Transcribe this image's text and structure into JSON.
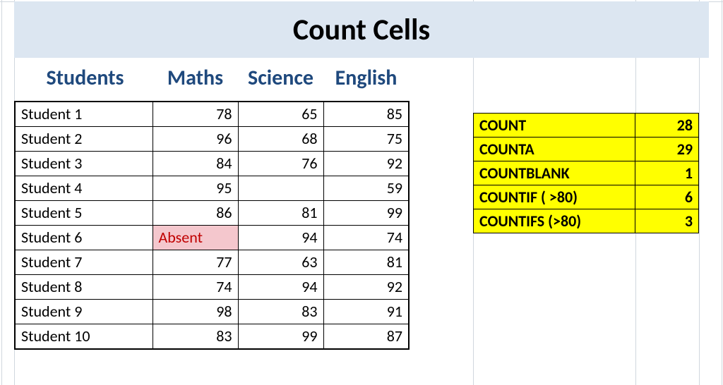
{
  "title": "Count Cells",
  "headers": {
    "students": "Students",
    "maths": "Maths",
    "science": "Science",
    "english": "English"
  },
  "rows": [
    {
      "name": "Student 1",
      "maths": "78",
      "science": "65",
      "english": "85",
      "maths_absent": false
    },
    {
      "name": "Student 2",
      "maths": "96",
      "science": "68",
      "english": "75",
      "maths_absent": false
    },
    {
      "name": "Student 3",
      "maths": "84",
      "science": "76",
      "english": "92",
      "maths_absent": false
    },
    {
      "name": "Student 4",
      "maths": "95",
      "science": "",
      "english": "59",
      "maths_absent": false
    },
    {
      "name": "Student 5",
      "maths": "86",
      "science": "81",
      "english": "99",
      "maths_absent": false
    },
    {
      "name": "Student 6",
      "maths": "Absent",
      "science": "94",
      "english": "74",
      "maths_absent": true
    },
    {
      "name": "Student 7",
      "maths": "77",
      "science": "63",
      "english": "81",
      "maths_absent": false
    },
    {
      "name": "Student 8",
      "maths": "74",
      "science": "94",
      "english": "92",
      "maths_absent": false
    },
    {
      "name": "Student 9",
      "maths": "98",
      "science": "83",
      "english": "91",
      "maths_absent": false
    },
    {
      "name": "Student 10",
      "maths": "83",
      "science": "99",
      "english": "87",
      "maths_absent": false
    }
  ],
  "summary": [
    {
      "label": "COUNT",
      "value": "28"
    },
    {
      "label": "COUNTA",
      "value": "29"
    },
    {
      "label": "COUNTBLANK",
      "value": "1"
    },
    {
      "label": "COUNTIF ( >80)",
      "value": "6"
    },
    {
      "label": "COUNTIFS (>80)",
      "value": "3"
    }
  ],
  "grid": {
    "vlines": [
      2,
      20,
      670,
      900,
      990,
      1022
    ],
    "hlines": [
      2
    ]
  }
}
